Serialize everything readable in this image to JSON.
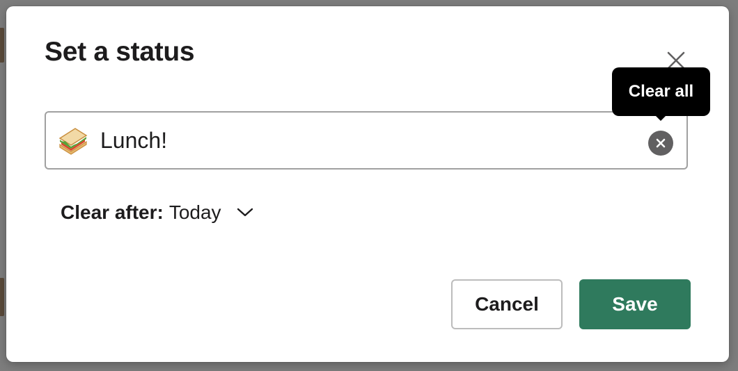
{
  "dialog": {
    "title": "Set a status"
  },
  "status": {
    "emoji": "sandwich",
    "value": "Lunch!",
    "clear_tooltip": "Clear all"
  },
  "clear_after": {
    "label": "Clear after:",
    "selected": "Today"
  },
  "actions": {
    "cancel_label": "Cancel",
    "save_label": "Save"
  },
  "colors": {
    "primary": "#2f7a5d",
    "tooltip_bg": "#000000",
    "clear_button": "#616061",
    "text": "#1d1c1d"
  },
  "icons": {
    "close": "close-icon",
    "clear": "clear-x-icon",
    "chevron": "chevron-down-icon",
    "emoji": "sandwich-emoji-icon"
  }
}
